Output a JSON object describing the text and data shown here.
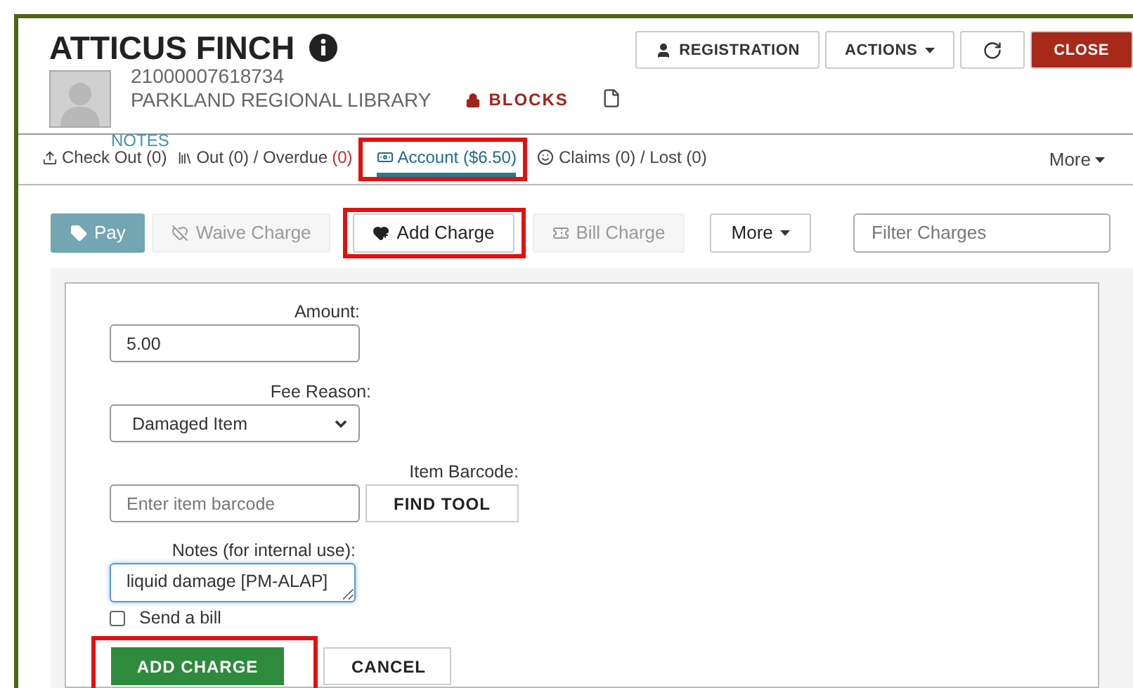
{
  "patron": {
    "name": "ATTICUS FINCH",
    "barcode": "21000007618734",
    "library": "PARKLAND REGIONAL LIBRARY",
    "notes_link": "NOTES",
    "blocks": "BLOCKS"
  },
  "header_buttons": [
    {
      "kind": "person",
      "label": "REGISTRATION"
    },
    {
      "kind": "dropdown",
      "label": "ACTIONS"
    },
    {
      "kind": "refresh"
    },
    {
      "kind": "danger",
      "label": "CLOSE"
    }
  ],
  "tabs": [
    {
      "kind": "checkout",
      "label": "Check Out (0)",
      "selected": false
    },
    {
      "kind": "out",
      "label": "Out (0) / Overdue",
      "alert": "(0)",
      "selected": false
    },
    {
      "kind": "account",
      "label": "Account ($6.50)",
      "selected": true,
      "highlighted": true
    },
    {
      "kind": "claims",
      "label": "Claims (0) / Lost (0)",
      "selected": false
    }
  ],
  "tabs_more": "More",
  "toolbar": {
    "buttons": [
      {
        "kind": "pay",
        "label": "Pay",
        "disabled": false
      },
      {
        "kind": "waive",
        "label": "Waive Charge",
        "disabled": true
      },
      {
        "kind": "add",
        "label": "Add Charge",
        "disabled": false,
        "highlighted": true
      },
      {
        "kind": "bill",
        "label": "Bill Charge",
        "disabled": true
      }
    ],
    "more": "More",
    "filter": {
      "placeholder": "Filter Charges"
    }
  },
  "form": {
    "amount": {
      "label": "Amount:",
      "value": "5.00"
    },
    "fee_reason": {
      "label": "Fee Reason:",
      "value": "Damaged Item"
    },
    "item_barcode": {
      "label": "Item Barcode:",
      "placeholder": "Enter item barcode",
      "button": "FIND TOOL"
    },
    "notes": {
      "label": "Notes (for internal use):",
      "value": "liquid damage [PM-ALAP]",
      "focused": true
    },
    "send_bill": {
      "label": "Send a bill",
      "checked": false
    },
    "submit": {
      "label": "ADD CHARGE",
      "highlighted": true
    },
    "cancel": {
      "label": "CANCEL"
    }
  }
}
